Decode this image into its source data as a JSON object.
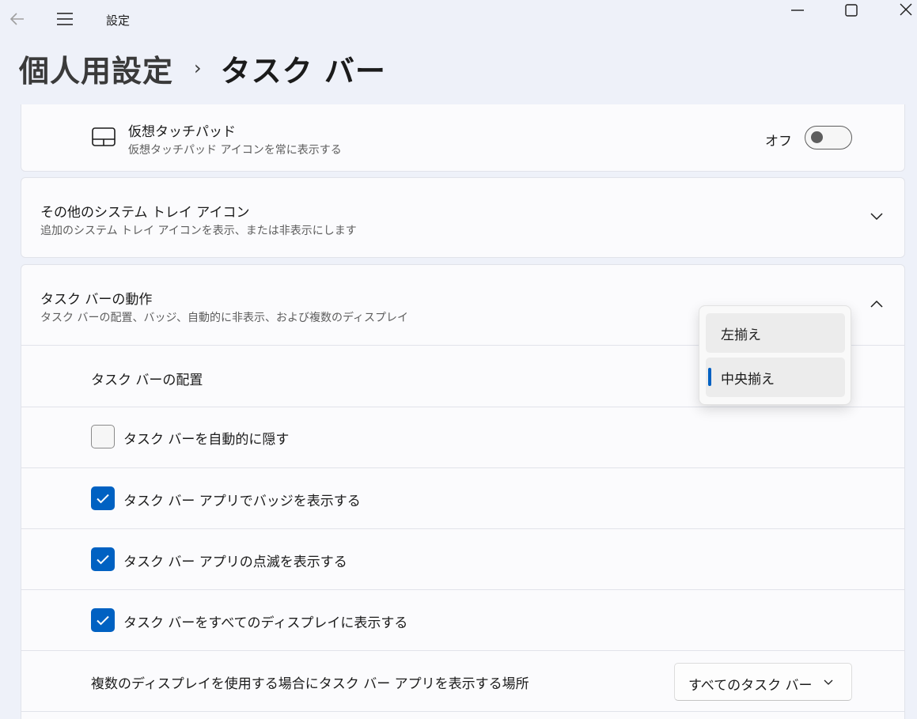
{
  "window": {
    "title": "設定"
  },
  "breadcrumb": {
    "parent": "個人用設定",
    "separator": "›",
    "current": "タスク バー"
  },
  "virtual_touchpad": {
    "title": "仮想タッチパッド",
    "subtitle": "仮想タッチパッド アイコンを常に表示する",
    "toggle_state_label": "オフ",
    "toggle_on": false
  },
  "other_tray_icons": {
    "title": "その他のシステム トレイ アイコン",
    "subtitle": "追加のシステム トレイ アイコンを表示、または非表示にします",
    "expanded": false
  },
  "taskbar_behavior": {
    "title": "タスク バーの動作",
    "subtitle": "タスク バーの配置、バッジ、自動的に非表示、および複数のディスプレイ",
    "expanded": true,
    "alignment_label": "タスク バーの配置",
    "alignment_options": [
      "左揃え",
      "中央揃え"
    ],
    "alignment_selected": "中央揃え",
    "checkboxes": [
      {
        "label": "タスク バーを自動的に隠す",
        "checked": false
      },
      {
        "label": "タスク バー アプリでバッジを表示する",
        "checked": true
      },
      {
        "label": "タスク バー アプリの点滅を表示する",
        "checked": true
      },
      {
        "label": "タスク バーをすべてのディスプレイに表示する",
        "checked": true
      }
    ],
    "multi_display_label": "複数のディスプレイを使用する場合にタスク バー アプリを表示する場所",
    "multi_display_value": "すべてのタスク バー"
  },
  "colors": {
    "accent": "#0061c2",
    "background": "#eef1f9",
    "card": "#fbfbfd"
  }
}
